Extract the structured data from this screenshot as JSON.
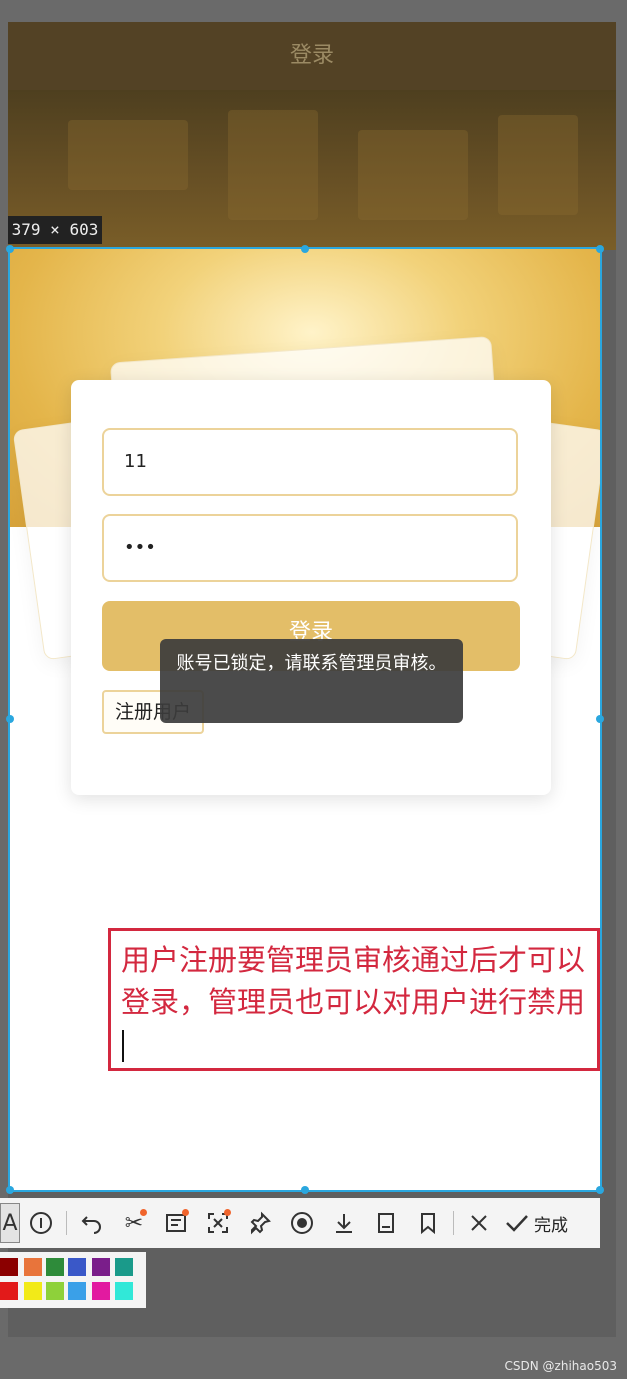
{
  "app": {
    "header_title": "登录"
  },
  "screenshot_tool": {
    "size_label": "379 × 603",
    "done_label": "完成"
  },
  "login": {
    "username_value": "11",
    "password_value": "•••",
    "login_button_label": "登录",
    "register_label": "注册用户"
  },
  "toast": {
    "message": "账号已锁定，请联系管理员审核。"
  },
  "annotation": {
    "text": "用户注册要管理员审核通过后才可以登录，管理员也可以对用户进行禁用"
  },
  "palette": {
    "row1": [
      "#8b0000",
      "#e8743b",
      "#2e8b3a",
      "#3a58c8",
      "#7a1e8a",
      "#1a9a8a"
    ],
    "row2": [
      "#e21a1a",
      "#f2ea18",
      "#8ed13a",
      "#3aa0e8",
      "#e21aa0",
      "#31e8d8"
    ]
  },
  "toolbar_icons": [
    "text-icon",
    "info-icon",
    "undo-icon",
    "cut-icon",
    "ocr-icon",
    "scan-icon",
    "pin-icon",
    "record-icon",
    "download-icon",
    "save-icon",
    "bookmark-icon",
    "close-icon",
    "check-icon"
  ],
  "watermark": "CSDN @zhihao503"
}
